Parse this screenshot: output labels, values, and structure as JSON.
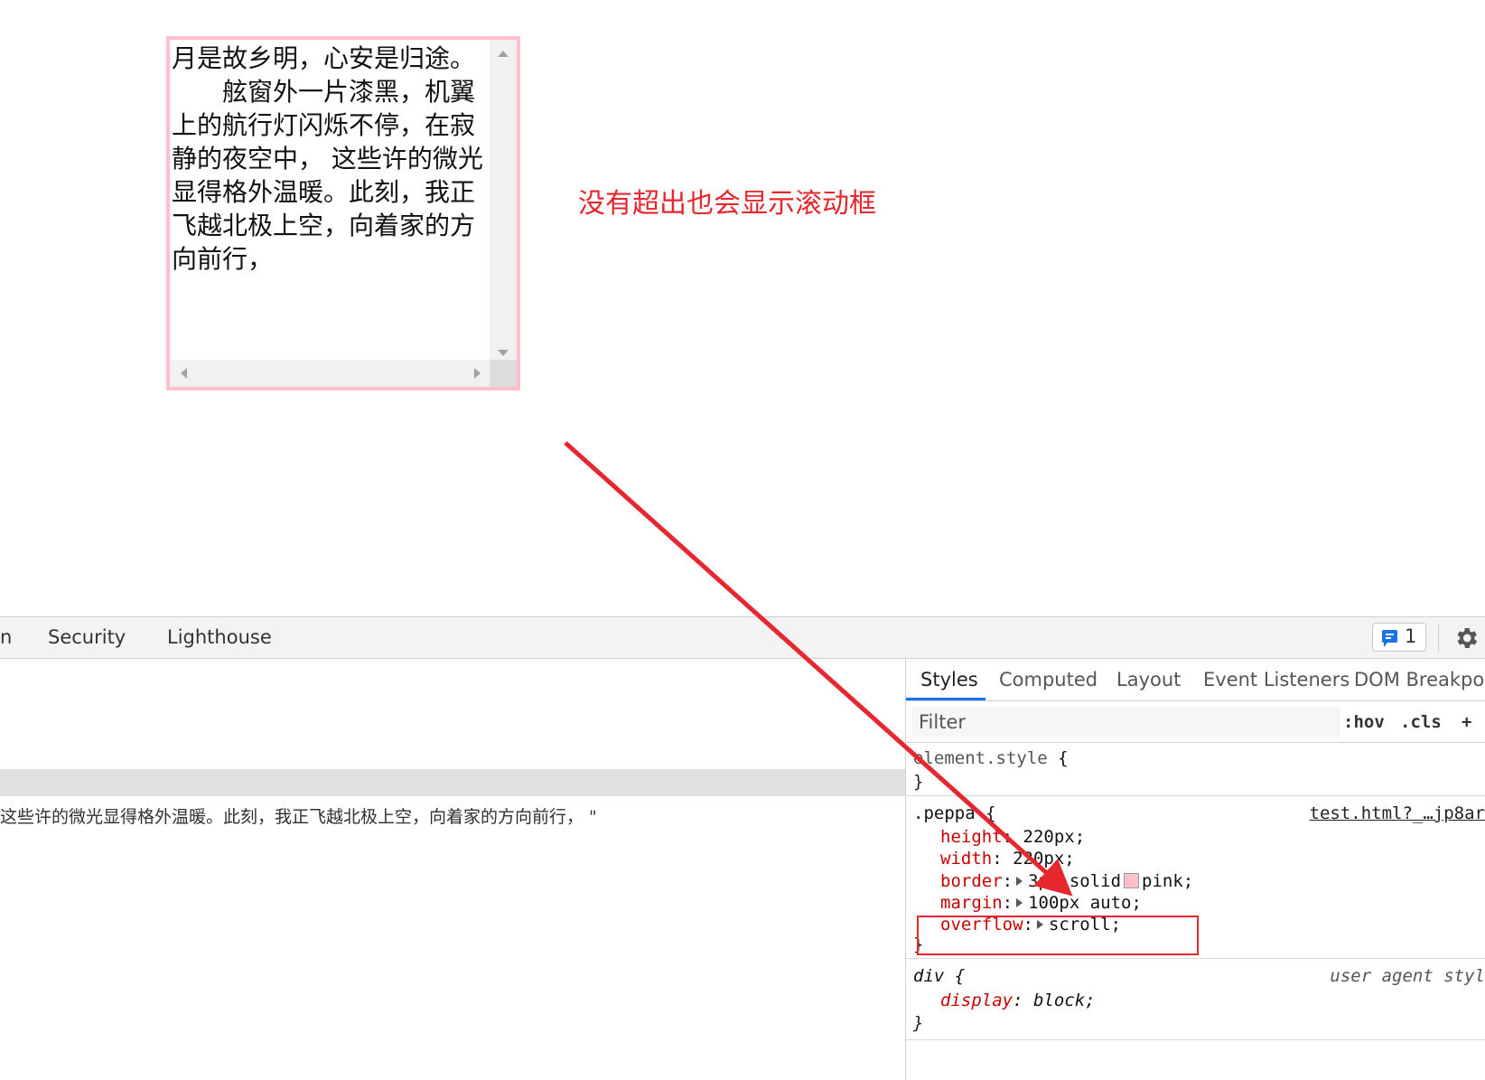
{
  "preview": {
    "title_line": "月是故乡明，心安是归途。",
    "body": "舷窗外一片漆黑，机翼上的航行灯闪烁不停，在寂静的夜空中， 这些许的微光显得格外温暖。此刻，我正飞越北极上空，向着家的方向前行，",
    "border_color": "#ffc0cb"
  },
  "annotation": {
    "text": "没有超出也会显示滚动框",
    "color": "#e8262d"
  },
  "devtools": {
    "tabs": {
      "partial": "n",
      "security": "Security",
      "lighthouse": "Lighthouse"
    },
    "issues_count": "1",
    "dom_text": "这些许的微光显得格外温暖。此刻，我正飞越北极上空，向着家的方向前行，  \"",
    "styles_tabs": [
      "Styles",
      "Computed",
      "Layout",
      "Event Listeners",
      "DOM Breakpoi"
    ],
    "filter_placeholder": "Filter",
    "hov": ":hov",
    "cls": ".cls",
    "plus": "+",
    "rules": {
      "element_style": {
        "selector": "element.style",
        "open": "{",
        "close": "}"
      },
      "peppa": {
        "selector": ".peppa",
        "open": "{",
        "close": "}",
        "source": "test.html?_…jp8ar",
        "props": [
          {
            "name": "height",
            "value": "220px;"
          },
          {
            "name": "width",
            "value": "220px;"
          },
          {
            "name": "border",
            "value": "3px solid",
            "value2": "pink;"
          },
          {
            "name": "margin",
            "value": "100px auto;"
          },
          {
            "name": "overflow",
            "value": "scroll;"
          }
        ]
      },
      "div": {
        "selector": "div",
        "open": "{",
        "close": "}",
        "source": "user agent styl",
        "props": [
          {
            "name": "display",
            "value": "block;"
          }
        ]
      }
    }
  }
}
